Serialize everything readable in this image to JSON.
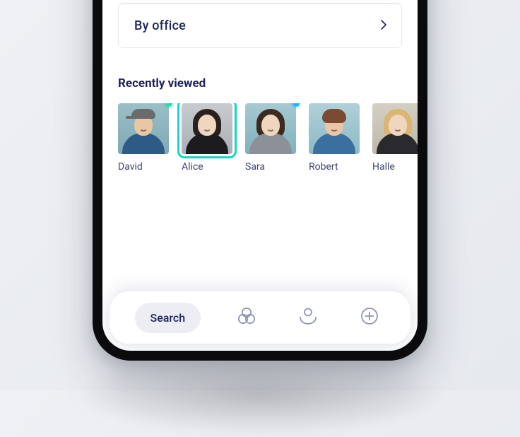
{
  "filter": {
    "by_office_label": "By office"
  },
  "section": {
    "recently_viewed_title": "Recently viewed"
  },
  "recent": [
    {
      "name": "David",
      "status": "green",
      "selected": false
    },
    {
      "name": "Alice",
      "status": null,
      "selected": true
    },
    {
      "name": "Sara",
      "status": "blue",
      "selected": false
    },
    {
      "name": "Robert",
      "status": null,
      "selected": false
    },
    {
      "name": "Halle",
      "status": null,
      "selected": false
    }
  ],
  "tabs": {
    "search_label": "Search"
  },
  "colors": {
    "accent_teal": "#14d6c4",
    "text_primary": "#1e2455",
    "icon_muted": "#8e95b8",
    "status_green": "#1ce0a5",
    "status_blue": "#18b8ff"
  }
}
